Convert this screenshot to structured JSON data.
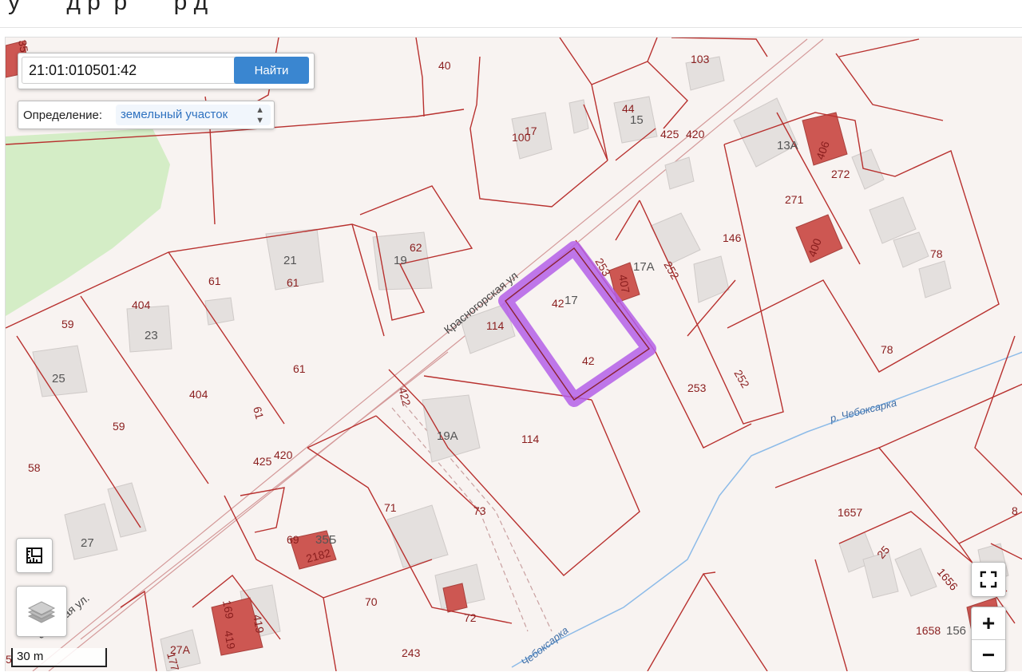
{
  "header": {
    "title_fragment": "у   ⁠ ⁠ ⁠ ⁠ ⁠ ⁠ ⁠д   ⁠р   ⁠ ⁠р   ⁠ ⁠ ⁠ ⁠ ⁠ ⁠ ⁠р  ⁠д"
  },
  "search": {
    "value": "21:01:010501:42",
    "button_label": "Найти"
  },
  "definition": {
    "label": "Определение:",
    "selected": "земельный участок"
  },
  "controls": {
    "zoom_in": "+",
    "zoom_out": "−",
    "scale_label": "30 m"
  },
  "colors": {
    "parcel_border": "#b8312f",
    "highlight": "#b25ce6",
    "building": "#e6e2e0",
    "building_red": "#cc5550",
    "river": "#7fb2e5",
    "park": "#d3edc4"
  },
  "labels": {
    "streets": [
      "Красногорская ул",
      "огорская ул."
    ],
    "rivers": [
      "р. Чебоксарка",
      "Чебоксарка"
    ],
    "parcels": [
      "40",
      "103",
      "17",
      "100",
      "44",
      "15",
      "425",
      "420",
      "13А",
      "406",
      "272",
      "271",
      "400",
      "146",
      "78",
      "253",
      "407",
      "17А",
      "252",
      "42",
      "17",
      "42",
      "42",
      "114",
      "21",
      "61",
      "61",
      "62",
      "19",
      "61",
      "404",
      "23",
      "59",
      "25",
      "404",
      "61",
      "59",
      "404",
      "422",
      "19А",
      "114",
      "253",
      "252",
      "78",
      "425",
      "420",
      "58",
      "71",
      "73",
      "69",
      "35Б",
      "2182",
      "1657",
      "25",
      "1656",
      "70",
      "72",
      "27",
      "169",
      "419",
      "419",
      "27А",
      "177",
      "243",
      "1658",
      "156",
      "8",
      "5",
      "35А"
    ]
  }
}
